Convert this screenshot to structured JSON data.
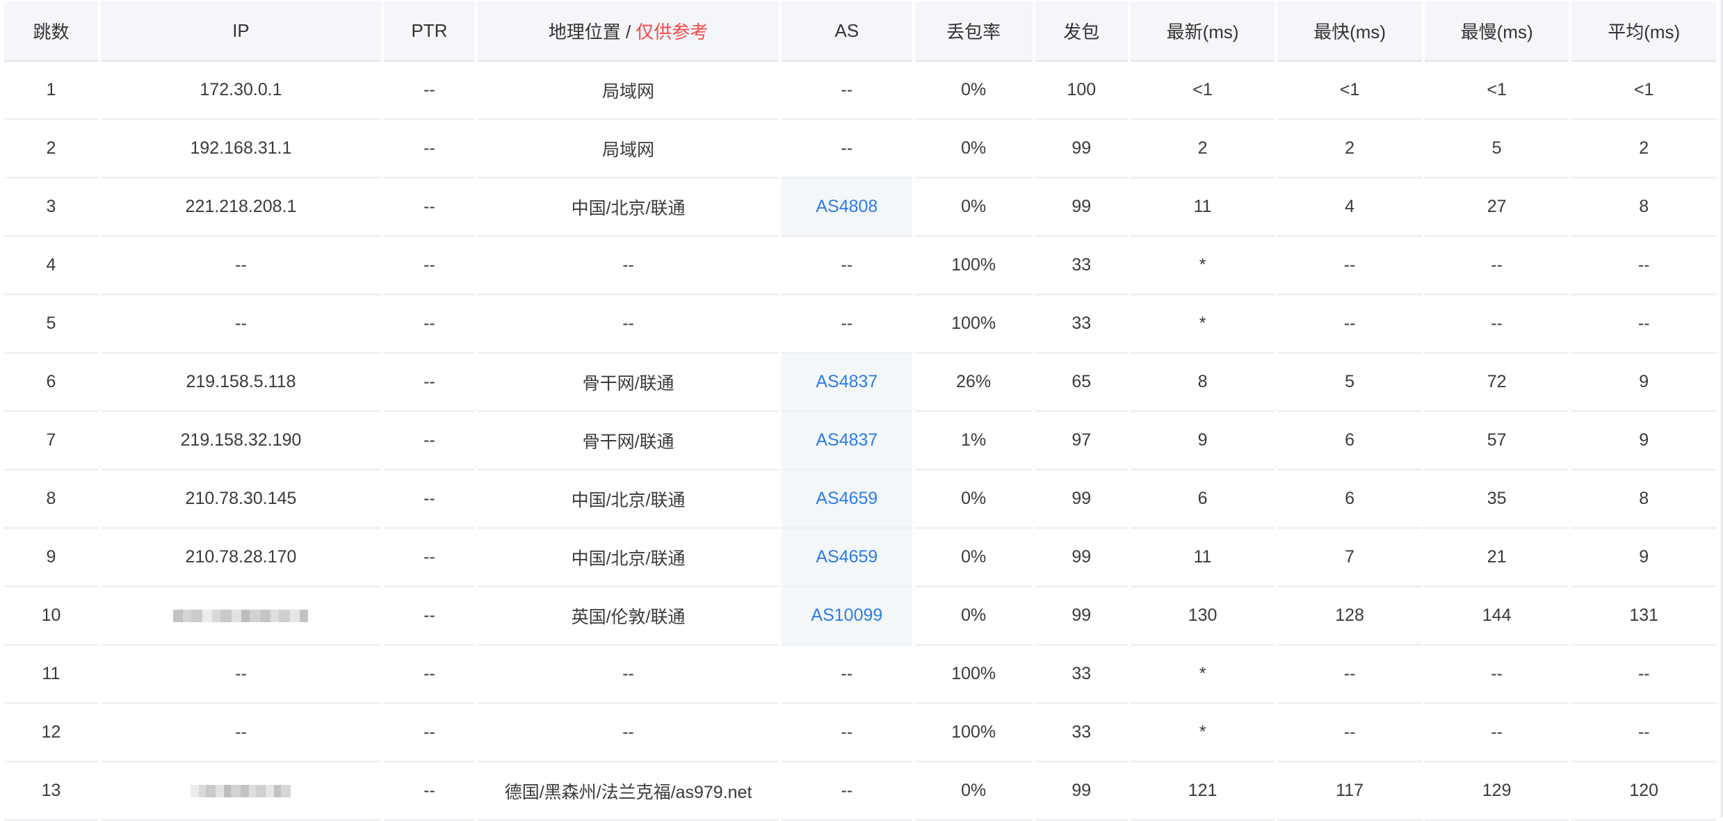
{
  "header": {
    "hop": "跳数",
    "ip": "IP",
    "ptr": "PTR",
    "geo_label": "地理位置",
    "geo_sep": "/",
    "geo_note": "仅供参考",
    "as": "AS",
    "loss": "丢包率",
    "sent": "发包",
    "last": "最新(ms)",
    "best": "最快(ms)",
    "worst": "最慢(ms)",
    "avg": "平均(ms)"
  },
  "colors": {
    "as_link": "#2d7ce6",
    "ref_note": "#f24a4a",
    "header_bg": "#f4f6f9"
  },
  "rows": [
    {
      "hop": "1",
      "ip": "172.30.0.1",
      "ptr": "--",
      "geo": "局域网",
      "as": "--",
      "loss": "0%",
      "sent": "100",
      "last": "<1",
      "best": "<1",
      "worst": "<1",
      "avg": "<1"
    },
    {
      "hop": "2",
      "ip": "192.168.31.1",
      "ptr": "--",
      "geo": "局域网",
      "as": "--",
      "loss": "0%",
      "sent": "99",
      "last": "2",
      "best": "2",
      "worst": "5",
      "avg": "2"
    },
    {
      "hop": "3",
      "ip": "221.218.208.1",
      "ptr": "--",
      "geo": "中国/北京/联通",
      "as": "AS4808",
      "loss": "0%",
      "sent": "99",
      "last": "11",
      "best": "4",
      "worst": "27",
      "avg": "8"
    },
    {
      "hop": "4",
      "ip": "--",
      "ptr": "--",
      "geo": "--",
      "as": "--",
      "loss": "100%",
      "sent": "33",
      "last": "*",
      "best": "--",
      "worst": "--",
      "avg": "--"
    },
    {
      "hop": "5",
      "ip": "--",
      "ptr": "--",
      "geo": "--",
      "as": "--",
      "loss": "100%",
      "sent": "33",
      "last": "*",
      "best": "--",
      "worst": "--",
      "avg": "--"
    },
    {
      "hop": "6",
      "ip": "219.158.5.118",
      "ptr": "--",
      "geo": "骨干网/联通",
      "as": "AS4837",
      "loss": "26%",
      "sent": "65",
      "last": "8",
      "best": "5",
      "worst": "72",
      "avg": "9"
    },
    {
      "hop": "7",
      "ip": "219.158.32.190",
      "ptr": "--",
      "geo": "骨干网/联通",
      "as": "AS4837",
      "loss": "1%",
      "sent": "97",
      "last": "9",
      "best": "6",
      "worst": "57",
      "avg": "9"
    },
    {
      "hop": "8",
      "ip": "210.78.30.145",
      "ptr": "--",
      "geo": "中国/北京/联通",
      "as": "AS4659",
      "loss": "0%",
      "sent": "99",
      "last": "6",
      "best": "6",
      "worst": "35",
      "avg": "8"
    },
    {
      "hop": "9",
      "ip": "210.78.28.170",
      "ptr": "--",
      "geo": "中国/北京/联通",
      "as": "AS4659",
      "loss": "0%",
      "sent": "99",
      "last": "11",
      "best": "7",
      "worst": "21",
      "avg": "9"
    },
    {
      "hop": "10",
      "ip": "",
      "ip_masked": true,
      "ptr": "--",
      "geo": "英国/伦敦/联通",
      "as": "AS10099",
      "loss": "0%",
      "sent": "99",
      "last": "130",
      "best": "128",
      "worst": "144",
      "avg": "131"
    },
    {
      "hop": "11",
      "ip": "--",
      "ptr": "--",
      "geo": "--",
      "as": "--",
      "loss": "100%",
      "sent": "33",
      "last": "*",
      "best": "--",
      "worst": "--",
      "avg": "--"
    },
    {
      "hop": "12",
      "ip": "--",
      "ptr": "--",
      "geo": "--",
      "as": "--",
      "loss": "100%",
      "sent": "33",
      "last": "*",
      "best": "--",
      "worst": "--",
      "avg": "--"
    },
    {
      "hop": "13",
      "ip": "",
      "ip_masked": true,
      "ptr": "--",
      "geo": "德国/黑森州/法兰克福/as979.net",
      "as": "--",
      "loss": "0%",
      "sent": "99",
      "last": "121",
      "best": "117",
      "worst": "129",
      "avg": "120"
    }
  ]
}
